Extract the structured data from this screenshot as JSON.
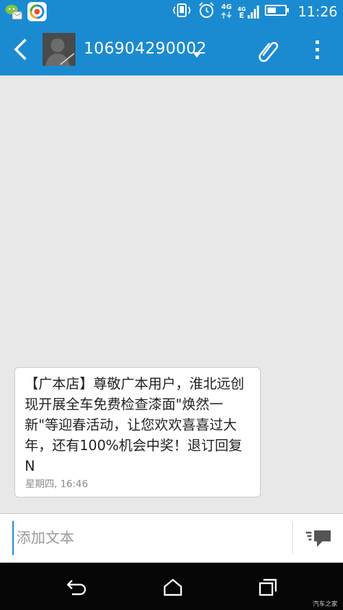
{
  "status_bar": {
    "time": "11:26",
    "network_type": "4G",
    "secondary_network": "4G",
    "secondary_network_sub": "E",
    "icons": [
      "wechat-message-icon",
      "baidu-app-icon",
      "vibrate-icon",
      "alarm-icon",
      "signal-icon",
      "battery-icon"
    ]
  },
  "header": {
    "contact_name": "106904290002",
    "icons": [
      "back-arrow-icon",
      "contact-avatar",
      "chevron-down-icon",
      "paperclip-icon",
      "more-vert-icon"
    ]
  },
  "conversation": {
    "messages": [
      {
        "text": "【广本店】尊敬广本用户，淮北远创现开展全车免费检查漆面\"焕然一新\"等迎春活动，让您欢欢喜喜过大年，还有100%机会中奖！退订回复N",
        "timestamp": "星期四, 16:46"
      }
    ]
  },
  "compose": {
    "placeholder": "添加文本",
    "value": "",
    "send_icon": "send-message-icon"
  },
  "nav_bar": {
    "icons": [
      "nav-back-icon",
      "nav-home-icon",
      "nav-recents-icon"
    ],
    "watermark": "汽车之家"
  },
  "colors": {
    "accent": "#1b8bd1",
    "background": "#e8e8e8",
    "bubble": "#ffffff",
    "nav_bar": "#050505"
  }
}
